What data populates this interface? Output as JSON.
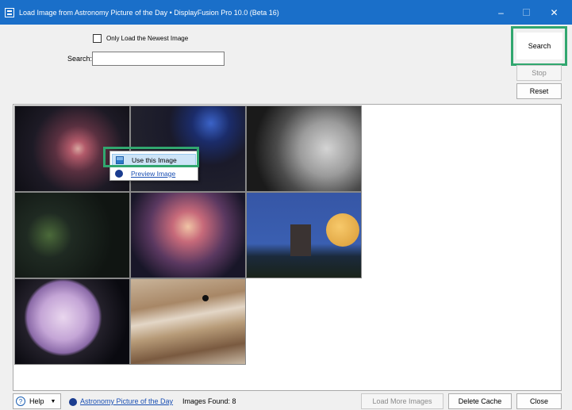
{
  "window": {
    "title": "Load Image from Astronomy Picture of the Day • DisplayFusion Pro 10.0 (Beta 16)",
    "controls": {
      "minimize": "–",
      "maximize": "☐",
      "close": "✕"
    }
  },
  "form": {
    "newest_only_label": "Only Load the Newest Image",
    "newest_only_checked": false,
    "search_label": "Search:",
    "search_value": ""
  },
  "buttons": {
    "search": "Search",
    "stop": "Stop",
    "reset": "Reset",
    "load_more": "Load More Images",
    "delete_cache": "Delete Cache",
    "close": "Close"
  },
  "thumbnails": [
    {
      "name": "Spiral galaxy"
    },
    {
      "name": "Rock silhouette with star cluster"
    },
    {
      "name": "Moon surface"
    },
    {
      "name": "Comet star field"
    },
    {
      "name": "Stephan's Quintet"
    },
    {
      "name": "Castle with full moon"
    },
    {
      "name": "Jupiter infrared"
    },
    {
      "name": "Jupiter cloud bands"
    }
  ],
  "context_menu": {
    "items": [
      {
        "label": "Use this Image",
        "icon": "image-icon"
      },
      {
        "label": "Preview Image",
        "icon": "nasa-icon"
      }
    ]
  },
  "footer": {
    "help_label": "Help",
    "apod_link": "Astronomy Picture of the Day",
    "images_found_label": "Images Found: 8"
  },
  "colors": {
    "titlebar": "#1a6fc9",
    "highlight": "#31a76f",
    "link": "#1a4fb3"
  }
}
